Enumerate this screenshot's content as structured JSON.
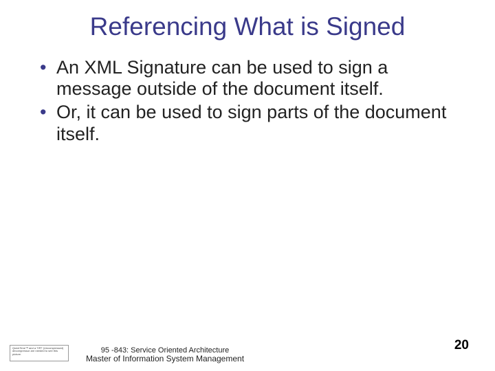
{
  "title": "Referencing What is Signed",
  "bullets": [
    "An XML Signature can be used to sign a message outside of the document itself.",
    "Or, it can be used to sign parts of the document itself."
  ],
  "placeholder": "QuickTime™ and a TIFF (Uncompressed) decompressor are needed to see this picture.",
  "footer": {
    "line1": "95 -843: Service Oriented Architecture",
    "line2": "Master of Information System Management"
  },
  "page_number": "20"
}
